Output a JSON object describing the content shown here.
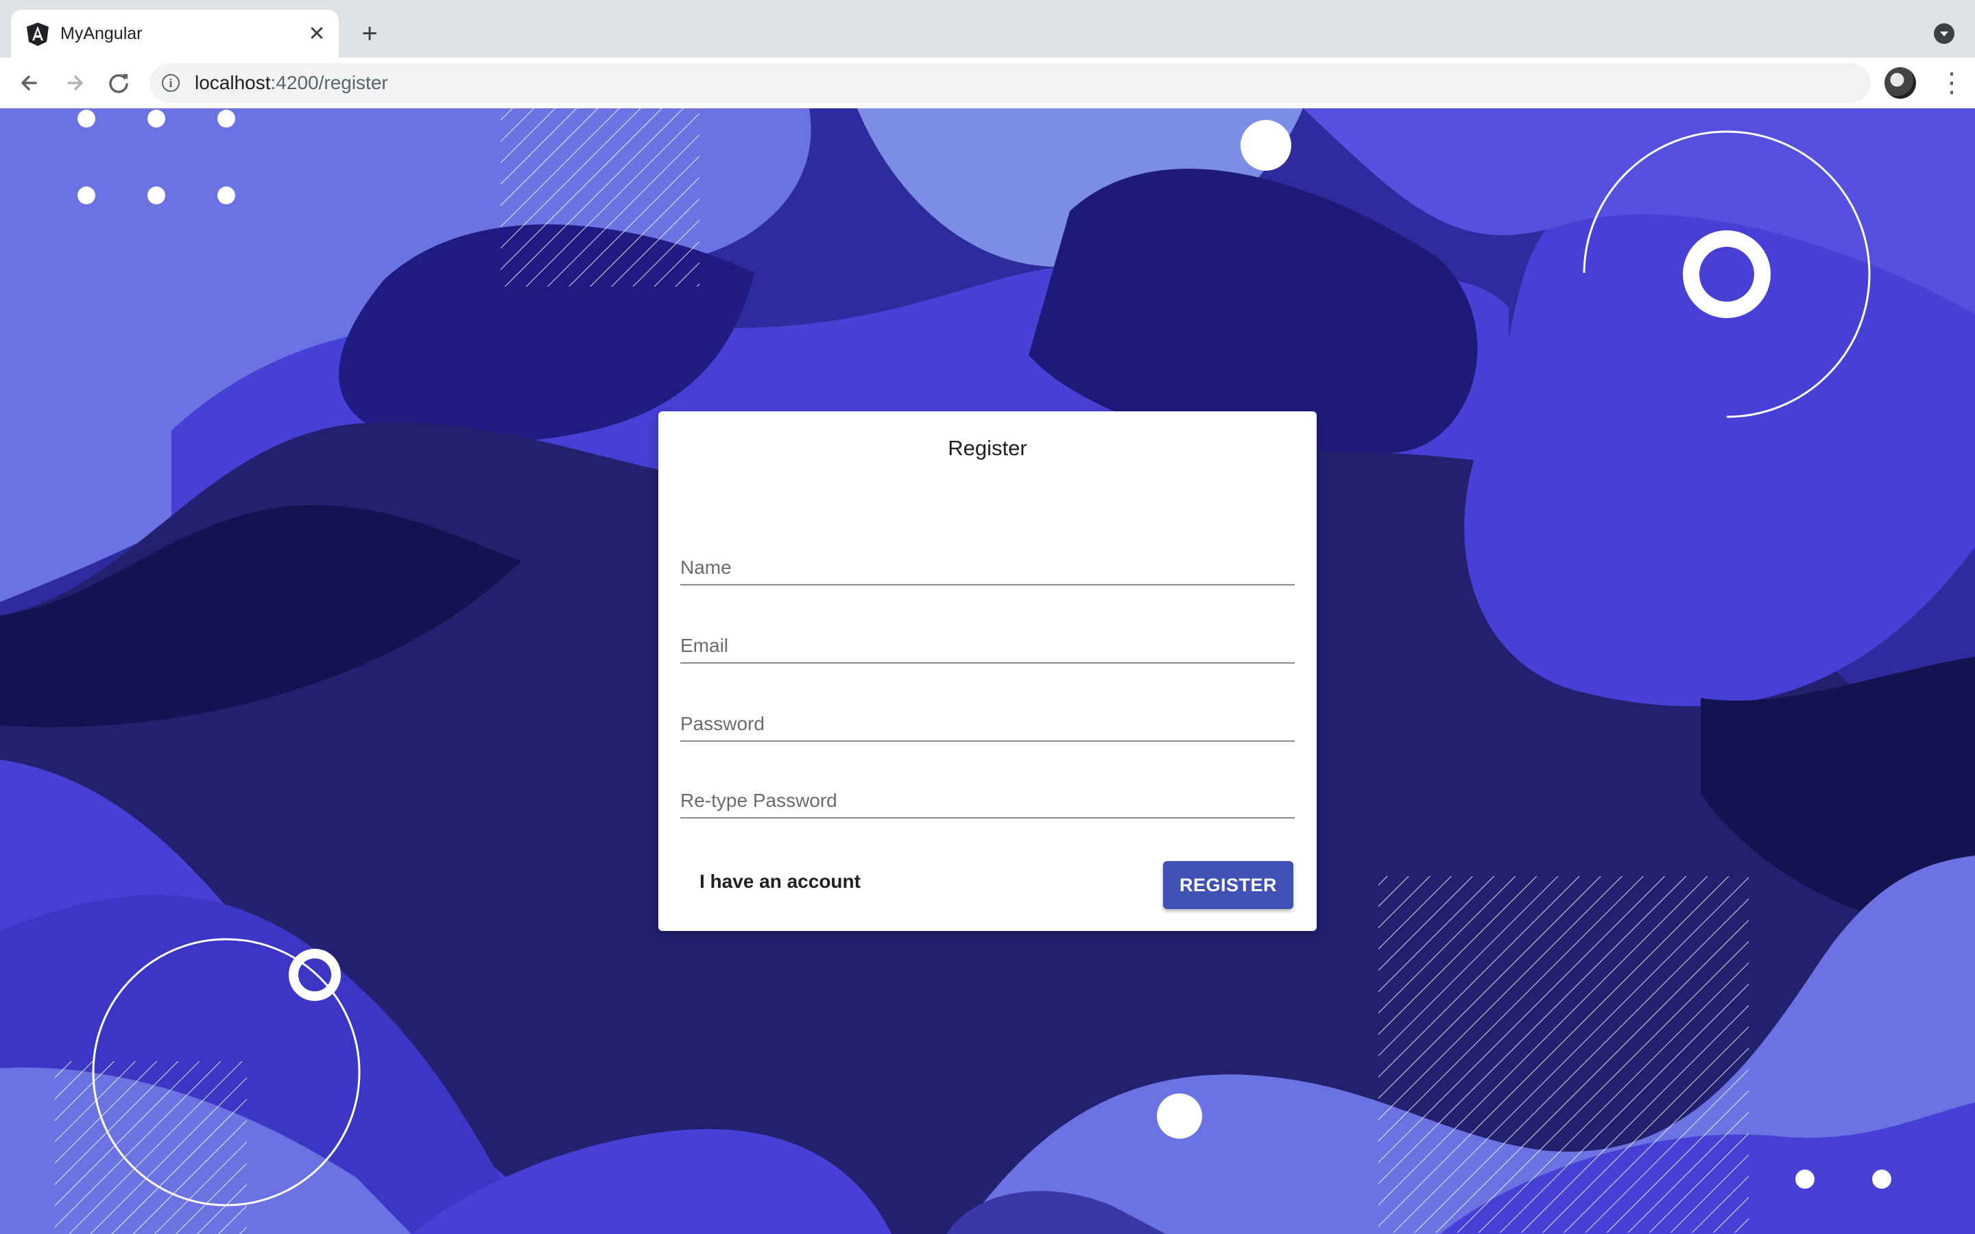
{
  "browser": {
    "tab_title": "MyAngular",
    "tab_close": "✕",
    "new_tab": "+",
    "url_host": "localhost",
    "url_path": ":4200/register",
    "icons": [
      "angular-icon",
      "close-icon",
      "plus-icon",
      "back-arrow-icon",
      "forward-arrow-icon",
      "reload-icon",
      "info-icon",
      "star-icon",
      "avatar",
      "menu-icon",
      "tab-search-icon"
    ]
  },
  "form": {
    "title": "Register",
    "fields": {
      "name_placeholder": "Name",
      "email_placeholder": "Email",
      "password_placeholder": "Password",
      "retype_placeholder": "Re-type Password"
    },
    "account_link": "I have an account",
    "submit_label": "REGISTER"
  },
  "colors": {
    "background_dark": "#23206f",
    "background_mid": "#4640d6",
    "background_light": "#6b73e3",
    "button": "#3f51b5"
  }
}
